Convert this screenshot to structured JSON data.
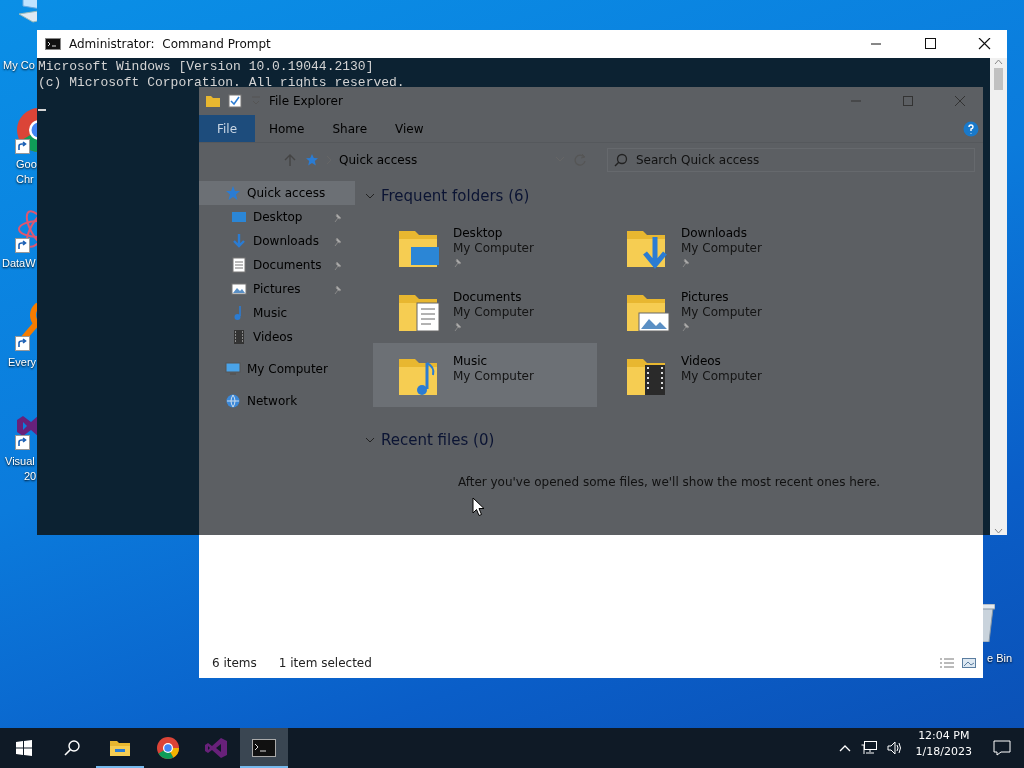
{
  "desktop_icons": [
    {
      "kind": "computer",
      "label_lines": [
        "My Co"
      ],
      "shortcut": false
    },
    {
      "kind": "chrome",
      "label_lines": [
        "Goo",
        "Chr"
      ],
      "shortcut": true
    },
    {
      "kind": "mesh",
      "label_lines": [
        "DataW"
      ],
      "shortcut": true
    },
    {
      "kind": "magnifier",
      "label_lines": [
        "Every"
      ],
      "shortcut": true
    },
    {
      "kind": "studio",
      "label_lines": [
        "Visual",
        "20"
      ],
      "shortcut": true
    },
    {
      "kind": "bin",
      "label_lines": [
        "e Bin"
      ],
      "shortcut": false
    }
  ],
  "explorer": {
    "title": "File Explorer",
    "tabs": [
      {
        "label": "File",
        "kind": "file"
      },
      {
        "label": "Home",
        "kind": "tab"
      },
      {
        "label": "Share",
        "kind": "tab"
      },
      {
        "label": "View",
        "kind": "tab"
      }
    ],
    "address": {
      "path": "Quick access"
    },
    "search": {
      "placeholder": "Search Quick access"
    },
    "nav": [
      {
        "label": "Quick access",
        "kind": "star",
        "selected": true,
        "children": [
          {
            "label": "Desktop",
            "kind": "desktop",
            "pinned": true,
            "selected": false
          },
          {
            "label": "Downloads",
            "kind": "downloads",
            "pinned": true,
            "selected": false
          },
          {
            "label": "Documents",
            "kind": "documents",
            "pinned": true,
            "selected": false
          },
          {
            "label": "Pictures",
            "kind": "pictures",
            "pinned": true,
            "selected": false
          },
          {
            "label": "Music",
            "kind": "music",
            "pinned": false,
            "selected": false
          },
          {
            "label": "Videos",
            "kind": "videos",
            "pinned": false,
            "selected": false
          }
        ]
      },
      {
        "label": "My Computer",
        "kind": "computer",
        "selected": false
      },
      {
        "label": "Network",
        "kind": "network",
        "selected": false
      }
    ],
    "sections": [
      {
        "heading": "Frequent folders (6)",
        "expanded": true,
        "tiles": [
          {
            "name": "Desktop",
            "location": "My Computer",
            "kind": "desktop",
            "pinned": true,
            "selected": false
          },
          {
            "name": "Downloads",
            "location": "My Computer",
            "kind": "downloads",
            "pinned": true,
            "selected": false
          },
          {
            "name": "Documents",
            "location": "My Computer",
            "kind": "documents",
            "pinned": true,
            "selected": false
          },
          {
            "name": "Pictures",
            "location": "My Computer",
            "kind": "pictures",
            "pinned": true,
            "selected": false
          },
          {
            "name": "Music",
            "location": "My Computer",
            "kind": "music",
            "pinned": false,
            "selected": true
          },
          {
            "name": "Videos",
            "location": "My Computer",
            "kind": "videos",
            "pinned": false,
            "selected": false
          }
        ]
      },
      {
        "heading": "Recent files (0)",
        "expanded": true,
        "message": "After you've opened some files, we'll show the most recent ones here."
      }
    ],
    "status": {
      "count": "6 items",
      "selection": "1 item selected"
    }
  },
  "cmd": {
    "title": "Administrator:  Command Prompt",
    "lines": [
      "Microsoft Windows [Version 10.0.19044.2130]",
      "(c) Microsoft Corporation. All rights reserved."
    ]
  },
  "taskbar": {
    "apps": [
      {
        "kind": "explorer",
        "active": false,
        "running": true
      },
      {
        "kind": "chrome",
        "active": false,
        "running": false
      },
      {
        "kind": "studio",
        "active": false,
        "running": false
      },
      {
        "kind": "console",
        "active": true,
        "running": true
      }
    ],
    "time": "12:04 PM",
    "date": "1/18/2023"
  }
}
